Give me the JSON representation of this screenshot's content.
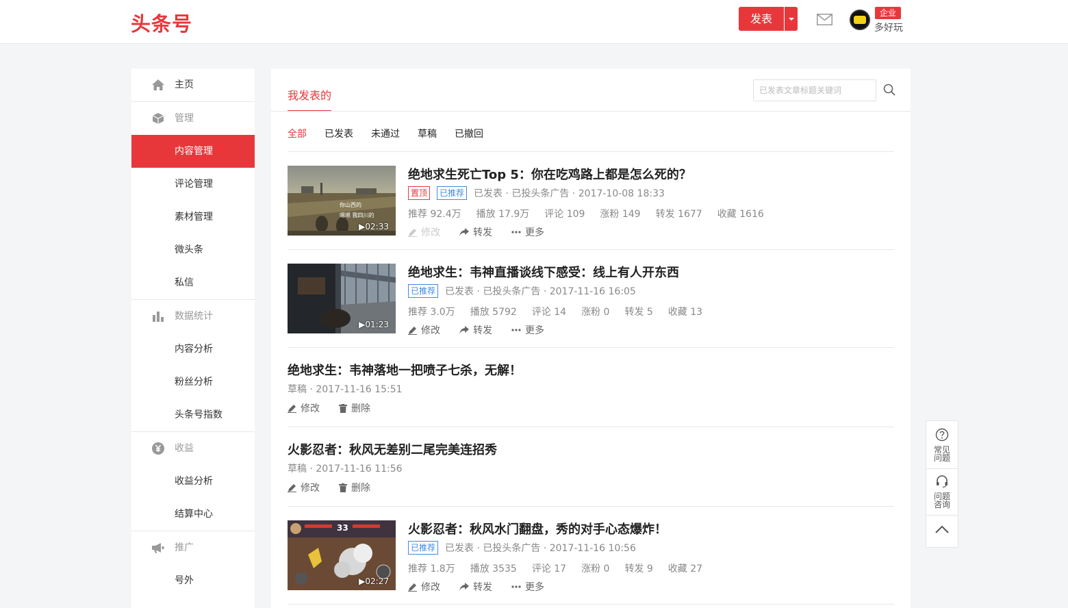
{
  "header": {
    "logo": "头条号",
    "publish_label": "发表",
    "enterprise_badge": "企业",
    "username": "多好玩"
  },
  "sidebar": {
    "items": [
      {
        "label": "主页",
        "icon": "home-icon",
        "type": "group"
      },
      {
        "label": "管理",
        "icon": "cube-icon",
        "type": "group"
      },
      {
        "label": "内容管理",
        "type": "sub",
        "active": true
      },
      {
        "label": "评论管理",
        "type": "sub"
      },
      {
        "label": "素材管理",
        "type": "sub"
      },
      {
        "label": "微头条",
        "type": "sub"
      },
      {
        "label": "私信",
        "type": "sub"
      },
      {
        "label": "数据统计",
        "icon": "bar-chart-icon",
        "type": "group"
      },
      {
        "label": "内容分析",
        "type": "sub"
      },
      {
        "label": "粉丝分析",
        "type": "sub"
      },
      {
        "label": "头条号指数",
        "type": "sub"
      },
      {
        "label": "收益",
        "icon": "yen-icon",
        "type": "group"
      },
      {
        "label": "收益分析",
        "type": "sub"
      },
      {
        "label": "结算中心",
        "type": "sub"
      },
      {
        "label": "推广",
        "icon": "megaphone-icon",
        "type": "group"
      },
      {
        "label": "号外",
        "type": "sub"
      }
    ]
  },
  "main": {
    "tab": "我发表的",
    "search_placeholder": "已发表文章标题关键词",
    "filters": [
      "全部",
      "已发表",
      "未通过",
      "草稿",
      "已撤回"
    ],
    "articles": [
      {
        "title": "绝地求生死亡Top 5：你在吃鸡路上都是怎么死的？",
        "duration": "02:33",
        "tags": [
          "置顶",
          "已推荐"
        ],
        "status": "已发表 · 已投头条广告 · 2017-10-08 18:33",
        "stats": [
          "推荐 92.4万",
          "播放 17.9万",
          "评论 109",
          "涨粉 149",
          "转发 1677",
          "收藏 1616"
        ],
        "actions": [
          "修改",
          "转发",
          "更多"
        ],
        "thumb_caption_1": "你山西的",
        "thumb_caption_2": "嗯嗯   我四川的"
      },
      {
        "title": "绝地求生：韦神直播谈线下感受：线上有人开东西",
        "duration": "01:23",
        "tags": [
          "已推荐"
        ],
        "status": "已发表 · 已投头条广告 · 2017-11-16 16:05",
        "stats": [
          "推荐 3.0万",
          "播放 5792",
          "评论 14",
          "涨粉 0",
          "转发 5",
          "收藏 13"
        ],
        "actions": [
          "修改",
          "转发",
          "更多"
        ]
      },
      {
        "title": "绝地求生：韦神落地一把喷子七杀，无解！",
        "status": "草稿 · 2017-11-16 15:51",
        "actions": [
          "修改",
          "删除"
        ]
      },
      {
        "title": "火影忍者：秋风无差别二尾完美连招秀",
        "status": "草稿 · 2017-11-16 11:56",
        "actions": [
          "修改",
          "删除"
        ]
      },
      {
        "title": "火影忍者：秋风水门翻盘，秀的对手心态爆炸！",
        "duration": "02:27",
        "tags": [
          "已推荐"
        ],
        "status": "已发表 · 已投头条广告 · 2017-11-16 10:56",
        "stats": [
          "推荐 1.8万",
          "播放 3535",
          "评论 17",
          "涨粉 0",
          "转发 9",
          "收藏 27"
        ],
        "actions": [
          "修改",
          "转发",
          "更多"
        ],
        "thumb_number": "33"
      }
    ]
  },
  "float_tools": {
    "faq": "常见问题",
    "consult": "问题咨询"
  },
  "colors": {
    "accent": "#e8373b",
    "tag_blue": "#3e8be0"
  }
}
